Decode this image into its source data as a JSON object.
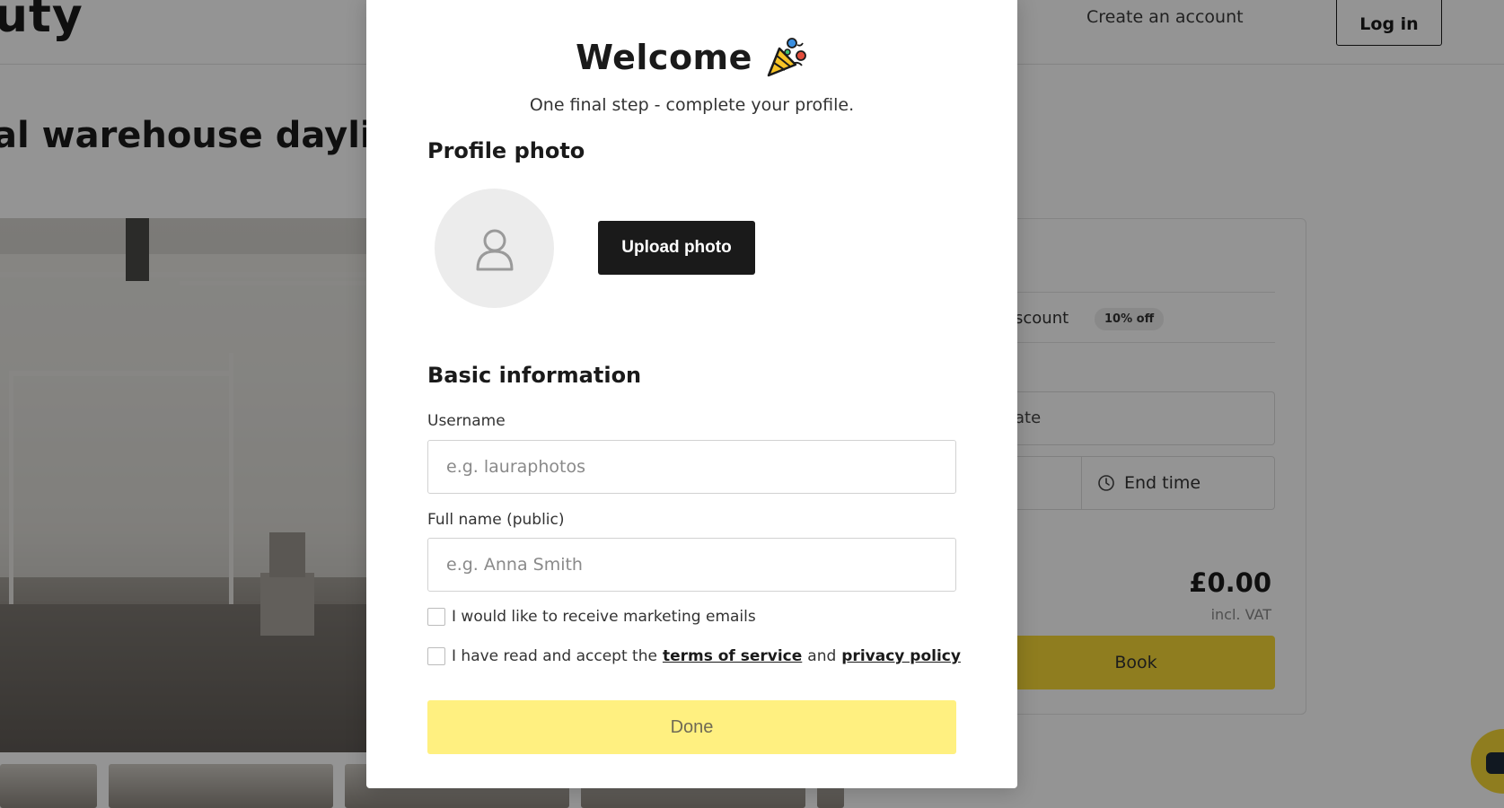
{
  "background": {
    "logo": "uty",
    "nav": {
      "create_account": "Create an account",
      "login": "Log in"
    },
    "listing_title": "al warehouse daylight",
    "booking_card": {
      "discount_label": "scount",
      "discount_badge": "10% off",
      "date_placeholder": "ate",
      "end_time_label": "End time",
      "total": "£0.00",
      "vat_note": "incl. VAT",
      "book_label": "Book"
    }
  },
  "modal": {
    "title": "Welcome",
    "title_icon": "party-popper-icon",
    "subtitle": "One final step - complete your profile.",
    "profile_photo_heading": "Profile photo",
    "avatar_icon": "user-icon",
    "upload_button": "Upload photo",
    "basic_info_heading": "Basic information",
    "username": {
      "label": "Username",
      "placeholder": "e.g. lauraphotos",
      "value": ""
    },
    "full_name": {
      "label": "Full name (public)",
      "placeholder": "e.g. Anna Smith",
      "value": ""
    },
    "marketing_checkbox": {
      "label": "I would like to receive marketing emails",
      "checked": false
    },
    "terms_checkbox": {
      "prefix": "I have read and accept the",
      "terms_link": "terms of service",
      "and": "and",
      "privacy_link": "privacy policy",
      "checked": false
    },
    "done_button": "Done"
  },
  "colors": {
    "accent_yellow": "#f6d836",
    "done_disabled_yellow": "#fff080",
    "primary_dark": "#1a1a1a",
    "overlay": "rgba(0,0,0,0.42)"
  }
}
